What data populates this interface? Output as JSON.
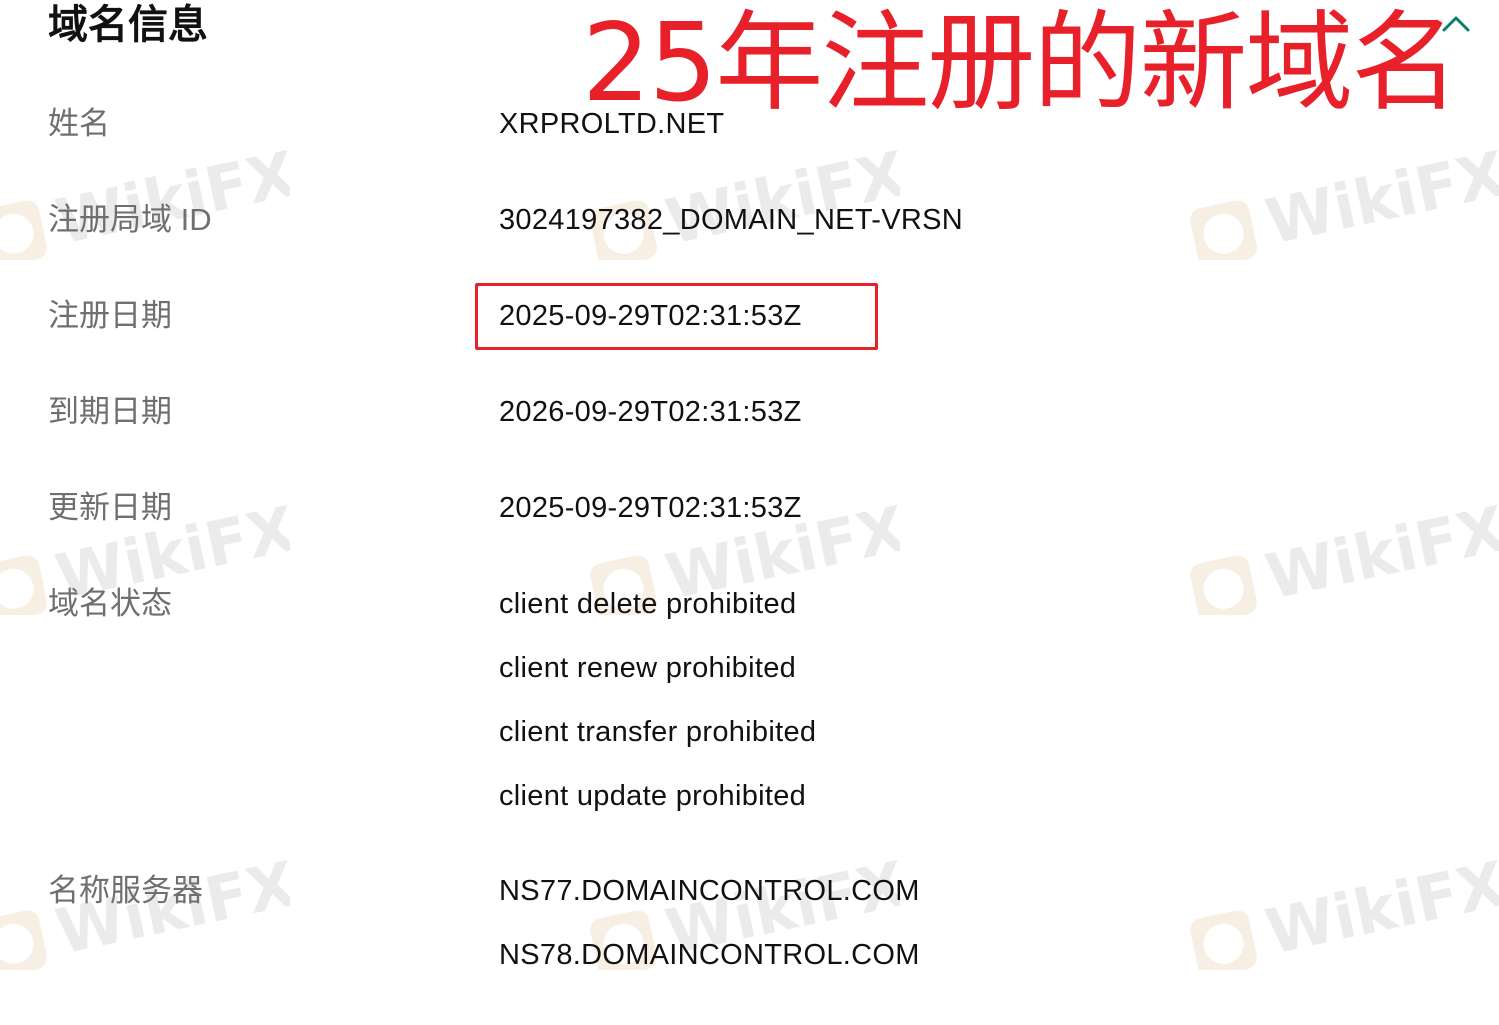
{
  "section": {
    "title": "域名信息",
    "collapse_icon": "chevron-up-icon"
  },
  "annotation": {
    "text": "25年注册的新域名",
    "color": "#e8202a"
  },
  "fields": {
    "name": {
      "label": "姓名",
      "value": "XRPROLTD.NET"
    },
    "registry_domain_id": {
      "label": "注册局域 ID",
      "value": "3024197382_DOMAIN_NET-VRSN"
    },
    "registration_date": {
      "label": "注册日期",
      "value": "2025-09-29T02:31:53Z"
    },
    "expiration_date": {
      "label": "到期日期",
      "value": "2026-09-29T02:31:53Z"
    },
    "updated_date": {
      "label": "更新日期",
      "value": "2025-09-29T02:31:53Z"
    },
    "domain_status": {
      "label": "域名状态",
      "values": [
        "client delete prohibited",
        "client renew prohibited",
        "client transfer prohibited",
        "client update prohibited"
      ]
    },
    "name_servers": {
      "label": "名称服务器",
      "values": [
        "NS77.DOMAINCONTROL.COM",
        "NS78.DOMAINCONTROL.COM"
      ]
    }
  },
  "watermark": {
    "text": "WikiFX",
    "icon": "wikifx-logo-icon"
  },
  "colors": {
    "accent": "#0a7d6e",
    "highlight": "#e8202a",
    "label": "#6f6f6f",
    "value": "#111111"
  }
}
